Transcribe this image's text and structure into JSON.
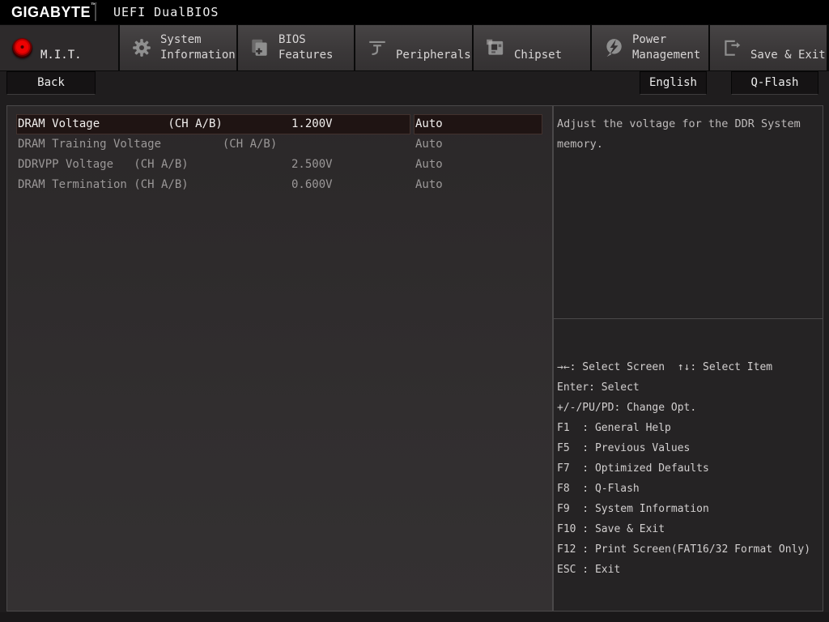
{
  "topbar": {
    "logo": "GIGABYTE",
    "trademark": "™",
    "title": "UEFI DualBIOS"
  },
  "tabbar": {
    "tabs": [
      {
        "name": "mit",
        "icon": "red-dot-icon",
        "lines": [
          "M.I.T."
        ],
        "active": true
      },
      {
        "name": "system-information",
        "icon": "gear-icon",
        "lines": [
          "System",
          "Information"
        ],
        "active": false
      },
      {
        "name": "bios-features",
        "icon": "documents-plus-icon",
        "lines": [
          "BIOS",
          "Features"
        ],
        "active": false
      },
      {
        "name": "peripherals",
        "icon": "peripherals-icon",
        "lines": [
          "Peripherals"
        ],
        "active": false
      },
      {
        "name": "chipset",
        "icon": "chip-icon",
        "lines": [
          "Chipset"
        ],
        "active": false
      },
      {
        "name": "power-management",
        "icon": "lightning-icon",
        "lines": [
          "Power",
          "Management"
        ],
        "active": false
      },
      {
        "name": "save-exit",
        "icon": "exit-door-icon",
        "lines": [
          "Save & Exit"
        ],
        "active": false
      }
    ]
  },
  "toolbar": {
    "back_label": "Back",
    "english_label": "English",
    "qflash_label": "Q-Flash"
  },
  "settings": {
    "rows": [
      {
        "label": "DRAM Voltage          (CH A/B)",
        "value": "1.200V",
        "option": "Auto",
        "selected": true
      },
      {
        "label": "DRAM Training Voltage         (CH A/B)",
        "value": "",
        "option": "Auto",
        "selected": false
      },
      {
        "label": "DDRVPP Voltage   (CH A/B)",
        "value": "2.500V",
        "option": "Auto",
        "selected": false
      },
      {
        "label": "DRAM Termination (CH A/B)",
        "value": "0.600V",
        "option": "Auto",
        "selected": false
      }
    ]
  },
  "help_panel": {
    "description": "Adjust the voltage for the DDR System memory."
  },
  "shortcuts": [
    "→←: Select Screen  ↑↓: Select Item",
    "Enter: Select",
    "+/-/PU/PD: Change Opt.",
    "F1  : General Help",
    "F5  : Previous Values",
    "F7  : Optimized Defaults",
    "F8  : Q-Flash",
    "F9  : System Information",
    "F10 : Save & Exit",
    "F12 : Print Screen(FAT16/32 Format Only)",
    "ESC : Exit"
  ],
  "colors": {
    "accent_red": "#ee0202",
    "selected_row_bg": "#1f1413",
    "tab_icon_gray": "#8f8f8f",
    "panel_border": "#4a4849"
  }
}
